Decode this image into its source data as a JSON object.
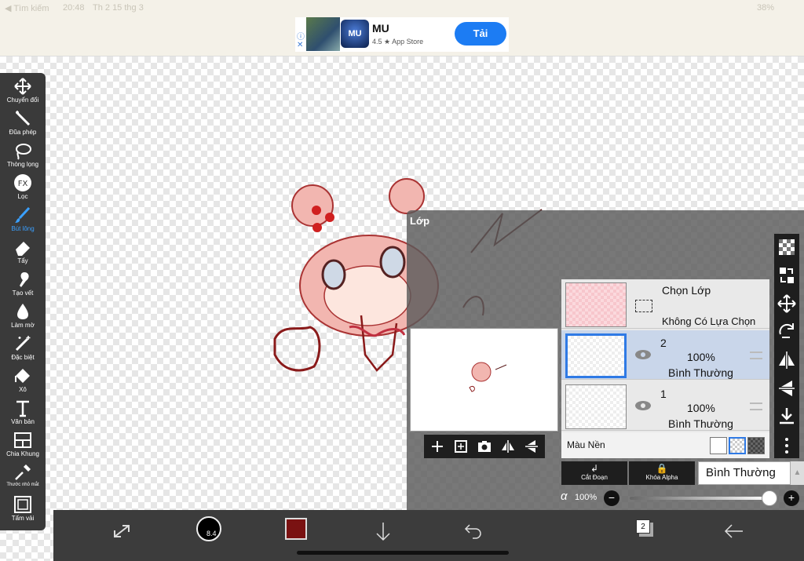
{
  "status": {
    "back": "◀ Tìm kiếm",
    "time": "20:48",
    "date": "Th 2 15 thg 3",
    "battery": "38%"
  },
  "ad": {
    "title": "MU",
    "rating": "4.5 ★ App Store",
    "button": "Tải",
    "icon_text": "MU"
  },
  "tools": [
    {
      "label": "Chuyển đổi",
      "icon": "move-icon"
    },
    {
      "label": "Đũa phép",
      "icon": "magic-wand-icon"
    },
    {
      "label": "Thòng lọng",
      "icon": "lasso-icon"
    },
    {
      "label": "Lọc",
      "icon": "fx-icon"
    },
    {
      "label": "Bút lông",
      "icon": "brush-icon"
    },
    {
      "label": "Tẩy",
      "icon": "eraser-icon"
    },
    {
      "label": "Tạo vết",
      "icon": "smudge-icon"
    },
    {
      "label": "Làm mờ",
      "icon": "blur-icon"
    },
    {
      "label": "Đặc biệt",
      "icon": "special-icon"
    },
    {
      "label": "Xô",
      "icon": "bucket-icon"
    },
    {
      "label": "Văn bản",
      "icon": "text-icon"
    },
    {
      "label": "Chia Khung",
      "icon": "frame-divider-icon"
    },
    {
      "label": "Thước nhỏ mắt",
      "icon": "eyedropper-icon"
    },
    {
      "label": "Tấm vải",
      "icon": "canvas-icon"
    }
  ],
  "layers_panel": {
    "title": "Lớp",
    "selection_row": {
      "title": "Chọn Lớp",
      "subtitle": "Không Có Lựa Chọn"
    },
    "layers": [
      {
        "number": "2",
        "opacity": "100%",
        "mode": "Bình Thường",
        "selected": true
      },
      {
        "number": "1",
        "opacity": "100%",
        "mode": "Bình Thường",
        "selected": false
      }
    ],
    "background_label": "Màu Nền",
    "clipping_label": "Cắt Đoạn",
    "alpha_lock_label": "Khóa Alpha",
    "blend_mode": "Bình Thường",
    "alpha_symbol": "α",
    "alpha_value": "100%"
  },
  "bottom": {
    "brush_size": "8.4",
    "color": "#7a1212",
    "layer_count": "2"
  },
  "colors": {
    "accent": "#2f7ae5",
    "toolbar_bg": "#3a3a3a",
    "active_tool": "#3aa0ff"
  }
}
